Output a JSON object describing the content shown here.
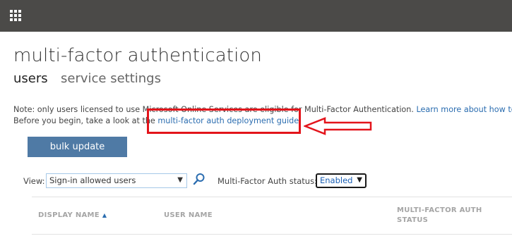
{
  "header": {
    "app_launcher_icon": "waffle-grid-icon"
  },
  "page": {
    "title": "multi-factor authentication",
    "tabs": [
      {
        "label": "users",
        "active": true
      },
      {
        "label": "service settings",
        "active": false
      }
    ]
  },
  "note": {
    "line1_text": "Note: only users licensed to use Microsoft Online Services are eligible for Multi-Factor Authentication. ",
    "line1_link": "Learn more about how to lic",
    "line2_text": "Before you begin, take a look at the ",
    "line2_link": "multi-factor auth deployment guide."
  },
  "toolbar": {
    "bulk_update_label": "bulk update"
  },
  "filters": {
    "view_label": "View:",
    "view_selected": "Sign-in allowed users",
    "search_icon": "search-icon",
    "mfa_status_label": "Multi-Factor Auth status:",
    "mfa_status_selected": "Enabled"
  },
  "table": {
    "columns": [
      "DISPLAY NAME",
      "USER NAME",
      "MULTI-FACTOR AUTH STATUS"
    ],
    "sort_icon": "sort-ascending-icon"
  },
  "annotation": {
    "highlight_color": "#e3141b",
    "arrow_icon": "left-arrow-icon"
  }
}
